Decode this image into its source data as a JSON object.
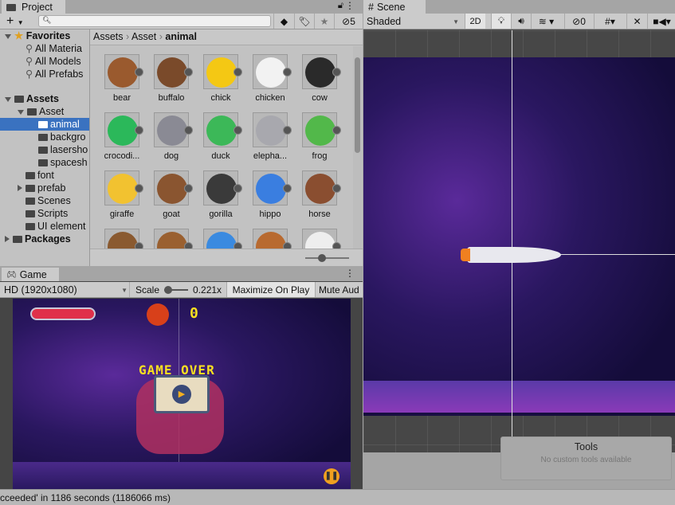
{
  "project": {
    "tab": "Project",
    "add": "+",
    "hidden_count": "5",
    "search_placeholder": "",
    "breadcrumb": [
      "Assets",
      "Asset",
      "animal"
    ],
    "tree": [
      {
        "label": "Favorites",
        "level": 0,
        "bold": true,
        "kind": "star",
        "expanded": true
      },
      {
        "label": "All Materia",
        "level": 1,
        "kind": "search"
      },
      {
        "label": "All Models",
        "level": 1,
        "kind": "search"
      },
      {
        "label": "All Prefabs",
        "level": 1,
        "kind": "search"
      },
      {
        "label": "Assets",
        "level": 0,
        "bold": true,
        "kind": "folder-open",
        "expanded": true
      },
      {
        "label": "Asset",
        "level": 1,
        "kind": "folder-open",
        "expanded": true
      },
      {
        "label": "animal",
        "level": 2,
        "kind": "folder",
        "selected": true
      },
      {
        "label": "backgro",
        "level": 2,
        "kind": "folder"
      },
      {
        "label": "lasersho",
        "level": 2,
        "kind": "folder"
      },
      {
        "label": "spacesh",
        "level": 2,
        "kind": "folder"
      },
      {
        "label": "font",
        "level": 1,
        "kind": "folder"
      },
      {
        "label": "prefab",
        "level": 1,
        "kind": "folder",
        "collapsed": true
      },
      {
        "label": "Scenes",
        "level": 1,
        "kind": "folder"
      },
      {
        "label": "Scripts",
        "level": 1,
        "kind": "folder"
      },
      {
        "label": "UI element",
        "level": 1,
        "kind": "folder"
      },
      {
        "label": "Packages",
        "level": 0,
        "bold": true,
        "kind": "folder",
        "collapsed": true
      }
    ],
    "assets": [
      {
        "label": "bear",
        "color": "#9a5a2e"
      },
      {
        "label": "buffalo",
        "color": "#7a4a2a"
      },
      {
        "label": "chick",
        "color": "#f4c814"
      },
      {
        "label": "chicken",
        "color": "#f2f2f2"
      },
      {
        "label": "cow",
        "color": "#2a2a2a"
      },
      {
        "label": "crocodi...",
        "color": "#2bb85a"
      },
      {
        "label": "dog",
        "color": "#8a8a94"
      },
      {
        "label": "duck",
        "color": "#3cb858"
      },
      {
        "label": "elepha...",
        "color": "#a8a8ae"
      },
      {
        "label": "frog",
        "color": "#52b84a"
      },
      {
        "label": "giraffe",
        "color": "#f2c230"
      },
      {
        "label": "goat",
        "color": "#8a5530"
      },
      {
        "label": "gorilla",
        "color": "#3a3a3a"
      },
      {
        "label": "hippo",
        "color": "#3a7ee0"
      },
      {
        "label": "horse",
        "color": "#8a4e30"
      },
      {
        "label": "",
        "color": "#8a5a30"
      },
      {
        "label": "",
        "color": "#9a6030"
      },
      {
        "label": "",
        "color": "#3a8ae0"
      },
      {
        "label": "",
        "color": "#b86a30"
      },
      {
        "label": "",
        "color": "#eeeeee"
      }
    ]
  },
  "game": {
    "tab": "Game",
    "resolution": "HD (1920x1080)",
    "scale_label": "Scale",
    "scale_value": "0.221x",
    "maximize": "Maximize On Play",
    "mute": "Mute Aud",
    "score": "0",
    "game_over": "GAME OVER"
  },
  "scene": {
    "tab": "Scene",
    "shading": "Shaded",
    "mode_2d": "2D",
    "hidden_count": "0",
    "tools_title": "Tools",
    "tools_msg": "No custom tools available"
  },
  "status": {
    "message": "cceeded' in 1186 seconds (1186066 ms)"
  }
}
